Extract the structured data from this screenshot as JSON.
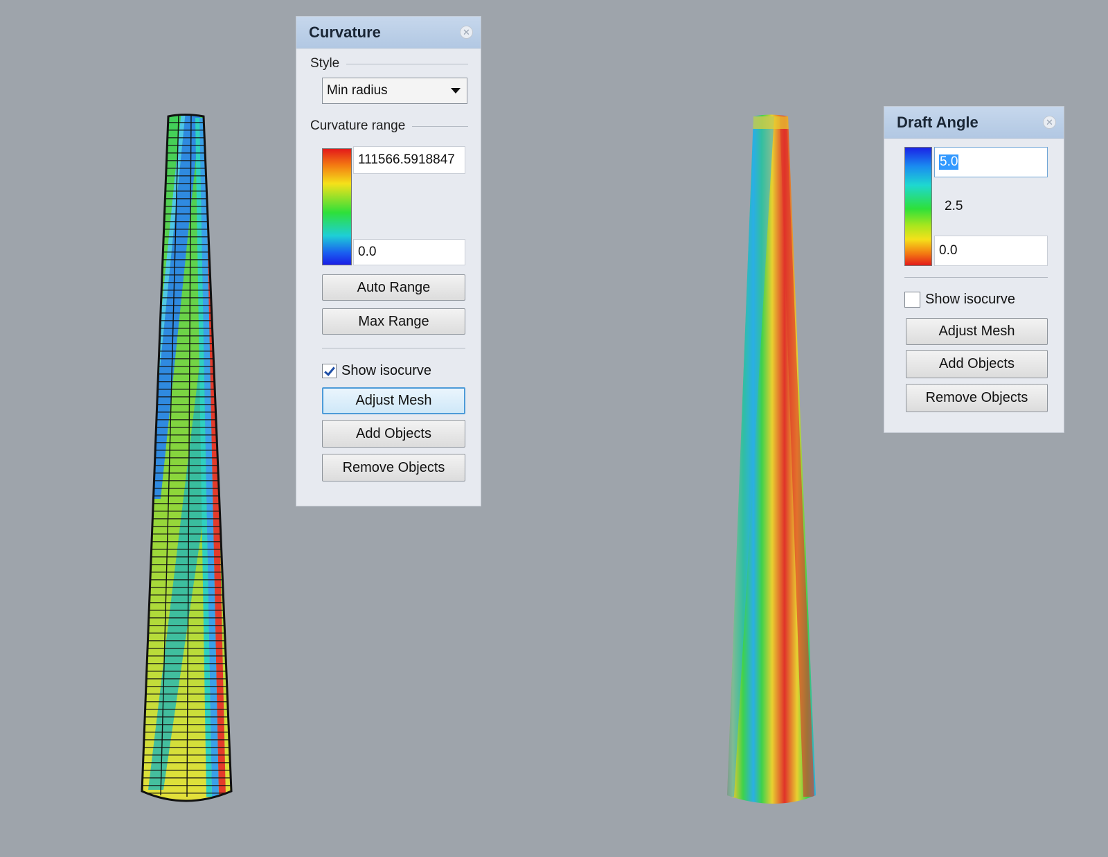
{
  "colors": {
    "viewport_bg": "#9ea4ab",
    "panel_bg": "#e7eaf0",
    "panel_header": "#b8cce6",
    "focus_border": "#4d9bd8",
    "selection": "#3399ff"
  },
  "curvature_panel": {
    "title": "Curvature",
    "close_icon": "close-icon",
    "style_label": "Style",
    "style_value": "Min radius",
    "range_label": "Curvature range",
    "range_max": "111566.5918847",
    "range_min": "0.0",
    "auto_range_label": "Auto Range",
    "max_range_label": "Max Range",
    "show_isocurve_label": "Show isocurve",
    "show_isocurve_checked": true,
    "adjust_mesh_label": "Adjust Mesh",
    "add_objects_label": "Add Objects",
    "remove_objects_label": "Remove Objects"
  },
  "draft_panel": {
    "title": "Draft Angle",
    "close_icon": "close-icon",
    "angle_max": "5.0",
    "angle_mid": "2.5",
    "angle_min": "0.0",
    "show_isocurve_label": "Show isocurve",
    "show_isocurve_checked": false,
    "adjust_mesh_label": "Adjust Mesh",
    "add_objects_label": "Add Objects",
    "remove_objects_label": "Remove Objects"
  }
}
